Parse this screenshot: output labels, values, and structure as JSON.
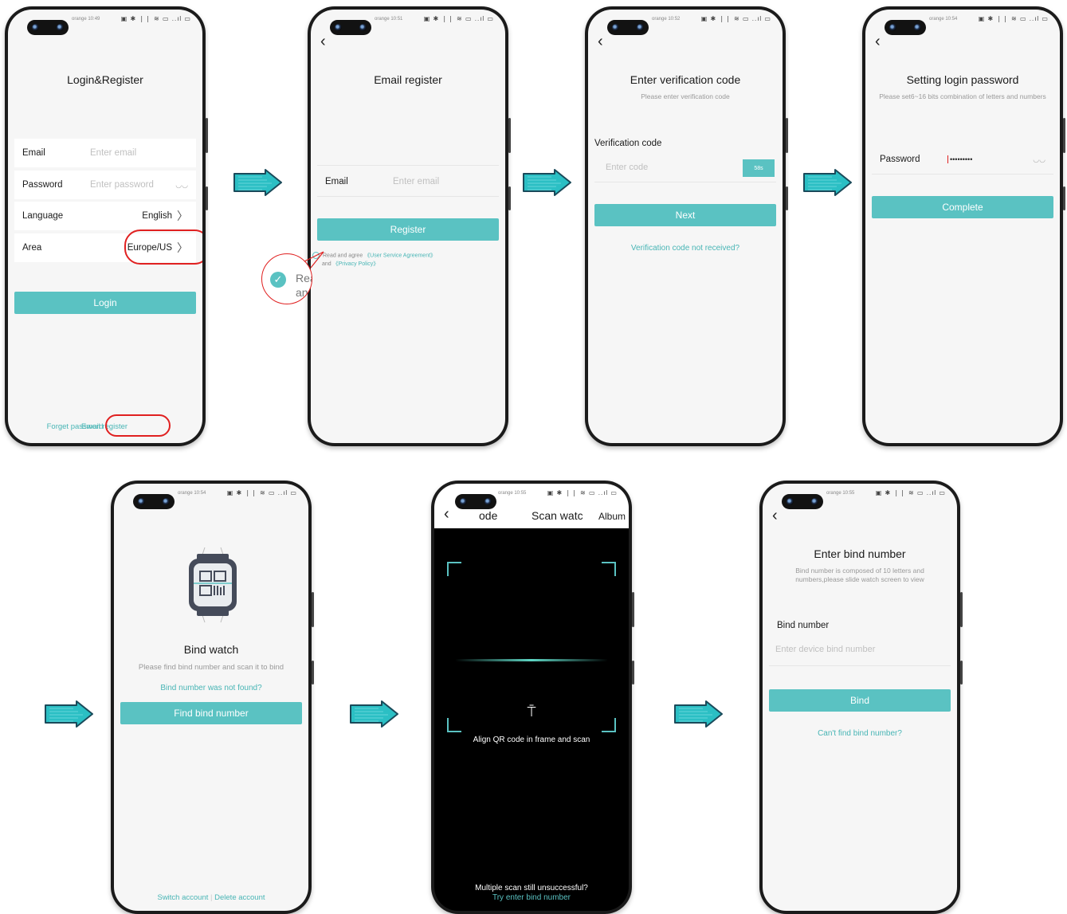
{
  "colors": {
    "accent": "#5ac2c2",
    "highlight": "#e02020",
    "arrow": "#2bbfc4"
  },
  "status": {
    "s1": "orange 10:49",
    "s2": "orange 10:51",
    "s3": "orange 10:52",
    "s4": "orange 10:54",
    "s5": "orange 10:54",
    "s6": "orange 10:55",
    "s7": "orange 10:55",
    "icons": "▣ ✱ ❘❘ ≋ ▭ ..ıl ▭"
  },
  "login": {
    "title": "Login&Register",
    "email_label": "Email",
    "email_placeholder": "Enter email",
    "password_label": "Password",
    "password_placeholder": "Enter password",
    "language_label": "Language",
    "language_value": "English",
    "area_label": "Area",
    "area_value": "Europe/US",
    "login_button": "Login",
    "forget_password": "Forget password",
    "email_register": "Email register"
  },
  "email_register": {
    "title": "Email register",
    "email_label": "Email",
    "email_placeholder": "Enter email",
    "register_button": "Register",
    "agree_text": "Read and agree",
    "user_agreement": "《User Service Agreement》",
    "and_text": "and",
    "privacy_policy": "《Privacy Policy》",
    "zoom_text_1": "Rea",
    "zoom_text_2": "an"
  },
  "verify": {
    "title": "Enter verification code",
    "subtitle": "Please enter verification code",
    "code_label": "Verification code",
    "code_placeholder": "Enter code",
    "countdown": "58s",
    "next_button": "Next",
    "not_received": "Verification code not received?"
  },
  "set_password": {
    "title": "Setting login password",
    "subtitle": "Please set6~16 bits combination of letters and numbers",
    "password_label": "Password",
    "password_value": "•••••••••",
    "complete_button": "Complete"
  },
  "bind_watch": {
    "title": "Bind watch",
    "subtitle": "Please find bind number and scan it to bind",
    "not_found_link": "Bind number was not found?",
    "find_button": "Find bind number",
    "switch_account": "Switch account",
    "delete_account": "Delete account"
  },
  "scan": {
    "title_left": "ode",
    "title_center": "Scan watc",
    "album": "Album",
    "align_text": "Align QR code in frame and scan",
    "unsuccessful": "Multiple scan still unsuccessful?",
    "try_enter": "Try enter bind number"
  },
  "enter_bind": {
    "title": "Enter bind number",
    "subtitle": "Bind number is composed of 10 letters and numbers,please slide watch screen to view",
    "bind_label": "Bind number",
    "bind_placeholder": "Enter device bind number",
    "bind_button": "Bind",
    "cant_find": "Can't find bind number?"
  }
}
